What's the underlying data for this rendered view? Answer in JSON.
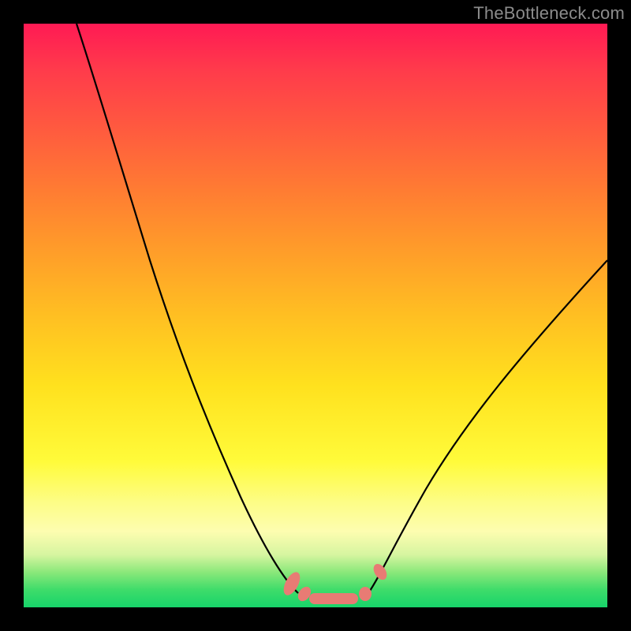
{
  "watermark": "TheBottleneck.com",
  "chart_data": {
    "type": "line",
    "title": "",
    "xlabel": "",
    "ylabel": "",
    "xlim": [
      0,
      100
    ],
    "ylim": [
      0,
      100
    ],
    "grid": false,
    "legend": false,
    "background": "rainbow-gradient-vertical",
    "series": [
      {
        "name": "curve-left",
        "color": "#000000",
        "x": [
          9,
          15,
          20,
          25,
          30,
          35,
          38,
          41,
          43,
          45,
          47
        ],
        "y": [
          100,
          82,
          66,
          51,
          37,
          25,
          18,
          12,
          8,
          5,
          3
        ]
      },
      {
        "name": "curve-right",
        "color": "#000000",
        "x": [
          59,
          62,
          66,
          72,
          80,
          90,
          100
        ],
        "y": [
          3,
          7,
          13,
          22,
          34,
          48,
          60
        ]
      },
      {
        "name": "valley-markers",
        "color": "#e87b74",
        "shape": "rounded",
        "x": [
          46,
          48,
          50,
          54.5,
          58.5,
          61
        ],
        "y": [
          4,
          2.3,
          1.8,
          1.7,
          2.3,
          6
        ]
      }
    ],
    "notes": "Axis ticks and numeric labels are not rendered in the source image; values are approximate positions on an inferred 0–100 scale."
  }
}
